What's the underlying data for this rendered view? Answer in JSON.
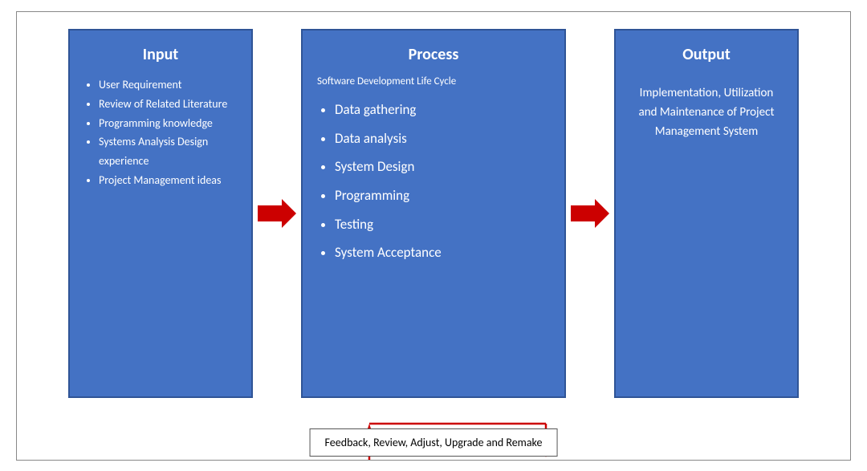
{
  "diagram": {
    "input": {
      "title": "Input",
      "items": [
        "User Requirement",
        "Review of Related Literature",
        "Programming knowledge",
        "Systems Analysis Design experience",
        "Project Management ideas"
      ]
    },
    "process": {
      "title": "Process",
      "subtitle": "Software Development Life Cycle",
      "items": [
        "Data gathering",
        "Data analysis",
        "System Design",
        "Programming",
        "Testing",
        "System Acceptance"
      ]
    },
    "output": {
      "title": "Output",
      "text": "Implementation, Utilization and Maintenance of Project Management System"
    },
    "feedback": {
      "label": "Feedback, Review, Adjust, Upgrade and Remake"
    }
  }
}
